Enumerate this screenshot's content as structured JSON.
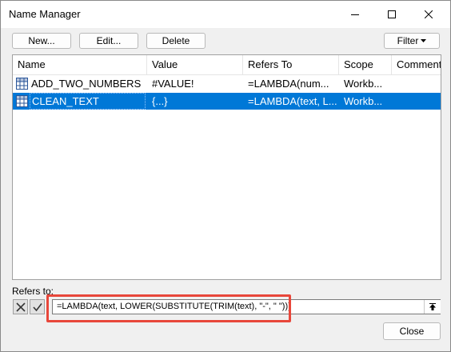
{
  "window": {
    "title": "Name Manager",
    "controls": {
      "minimize_icon": "minimize-icon",
      "maximize_icon": "maximize-icon",
      "close_icon": "close-icon"
    }
  },
  "toolbar": {
    "new_label": "New...",
    "edit_label": "Edit...",
    "delete_label": "Delete",
    "filter_label": "Filter"
  },
  "table": {
    "columns": [
      "Name",
      "Value",
      "Refers To",
      "Scope",
      "Comment"
    ],
    "rows": [
      {
        "name": "ADD_TWO_NUMBERS",
        "value": "#VALUE!",
        "refers_to": "=LAMBDA(num...",
        "scope": "Workb...",
        "comment": "",
        "selected": false
      },
      {
        "name": "CLEAN_TEXT",
        "value": "{...}",
        "refers_to": "=LAMBDA(text, L...",
        "scope": "Workb...",
        "comment": "",
        "selected": true
      }
    ]
  },
  "refers_to": {
    "label": "Refers to:",
    "formula": "=LAMBDA(text, LOWER(SUBSTITUTE(TRIM(text), \"-\", \" \")))"
  },
  "footer": {
    "close_label": "Close"
  },
  "colors": {
    "selection": "#0078d7",
    "highlight": "#e8473b",
    "grid_icon": "#2b579a"
  }
}
